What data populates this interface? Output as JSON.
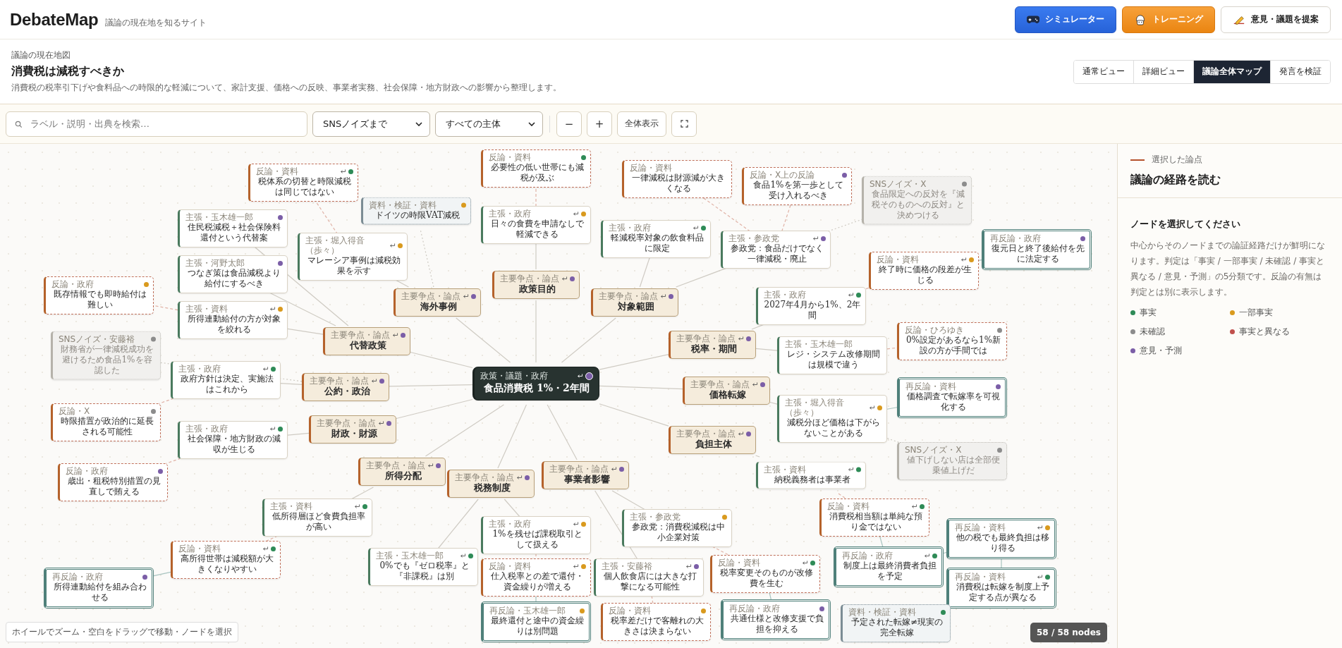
{
  "header": {
    "logo": "DebateMap",
    "tagline": "議論の現在地を知るサイト",
    "buttons": [
      {
        "label": "シミュレーター",
        "kind": "simulator"
      },
      {
        "label": "トレーニング",
        "kind": "training"
      },
      {
        "label": "意見・議題を提案",
        "kind": "propose"
      }
    ]
  },
  "topic": {
    "eyebrow": "議論の現在地図",
    "title": "消費税は減税すべきか",
    "description": "消費税の税率引下げや食料品への時限的な軽減について、家計支援、価格への反映、事業者実務、社会保障・地方財政への影響から整理します。"
  },
  "views": [
    {
      "label": "通常ビュー",
      "selected": false
    },
    {
      "label": "詳細ビュー",
      "selected": false
    },
    {
      "label": "議論全体マップ",
      "selected": true
    },
    {
      "label": "発言を検証",
      "selected": false
    }
  ],
  "toolbar": {
    "search": {
      "placeholder": "ラベル・説明・出典を検索…"
    },
    "filters": [
      {
        "value": "SNSノイズまで"
      },
      {
        "value": "すべての主体"
      }
    ],
    "zoom_buttons": [
      "−",
      "+"
    ],
    "fit_button": "全体表示"
  },
  "map": {
    "root": {
      "kind": "root",
      "meta": "政策・議題・政府",
      "label": "食品消費税 1%・2年間",
      "color": "#7b5ea7",
      "reply": true,
      "children": [
        {
          "kind": "issue",
          "meta": "主要争点・論点",
          "label": "代替政策",
          "color": "#7b5ea7",
          "reply": true,
          "children": [
            {
              "kind": "claim",
              "meta": "主張・玉木雄一郎",
              "label": "住民税減税＋社会保険料還付という代替案",
              "color": "#7b5ea7",
              "reply": false
            },
            {
              "kind": "claim",
              "meta": "主張・河野太郎",
              "label": "つなぎ策は食品減税より給付にするべき",
              "color": "#7b5ea7",
              "reply": false
            },
            {
              "kind": "claim",
              "meta": "主張・資料",
              "label": "所得連動給付の方が対象を絞れる",
              "color": "#d99a1e",
              "reply": true,
              "children": [
                {
                  "kind": "rebuttal",
                  "meta": "反論・政府",
                  "label": "既存情報でも即時給付は難しい",
                  "color": "#d99a1e",
                  "reply": false
                }
              ]
            }
          ]
        },
        {
          "kind": "issue",
          "meta": "主要争点・論点",
          "label": "海外事例",
          "color": "#7b5ea7",
          "reply": true,
          "children": [
            {
              "kind": "claim",
              "meta": "主張・堀入得音（歩々）",
              "label": "マレーシア事例は減税効果を示す",
              "color": "#d99a1e",
              "reply": true,
              "children": [
                {
                  "kind": "rebuttal",
                  "meta": "反論・資料",
                  "label": "税体系の切替と時限減税は同じではない",
                  "color": "#2e8b57",
                  "reply": true
                }
              ]
            },
            {
              "kind": "source",
              "meta": "資料・検証・資料",
              "label": "ドイツの時限VAT減税",
              "color": "#d99a1e",
              "reply": false
            }
          ]
        },
        {
          "kind": "issue",
          "meta": "主要争点・論点",
          "label": "政策目的",
          "color": "#7b5ea7",
          "reply": true,
          "children": [
            {
              "kind": "claim",
              "meta": "主張・政府",
              "label": "日々の食費を申請なしで軽減できる",
              "color": "#d99a1e",
              "reply": true,
              "children": [
                {
                  "kind": "rebuttal",
                  "meta": "反論・資料",
                  "label": "必要性の低い世帯にも減税が及ぶ",
                  "color": "#2e8b57",
                  "reply": false
                }
              ]
            }
          ]
        },
        {
          "kind": "issue",
          "meta": "主要争点・論点",
          "label": "対象範囲",
          "color": "#7b5ea7",
          "reply": true,
          "children": [
            {
              "kind": "claim",
              "meta": "主張・政府",
              "label": "軽減税率対象の飲食料品に限定",
              "color": "#2e8b57",
              "reply": true
            },
            {
              "kind": "claim",
              "meta": "主張・参政党",
              "label": "参政党：食品だけでなく一律減税・廃止",
              "color": "#7b5ea7",
              "reply": true,
              "children": [
                {
                  "kind": "rebuttal",
                  "meta": "反論・資料",
                  "label": "一律減税は財源減が大きくなる",
                  "reply": false
                },
                {
                  "kind": "rebuttal",
                  "meta": "反論・X上の反論",
                  "label": "食品1%を第一歩として受け入れるべき",
                  "color": "#7b5ea7",
                  "reply": false
                },
                {
                  "kind": "noise",
                  "meta": "SNSノイズ・X",
                  "label": "食品限定への反対を『減税そのものへの反対』と決めつける",
                  "color": "#8c8c8c",
                  "reply": false
                }
              ]
            }
          ]
        },
        {
          "kind": "issue",
          "meta": "主要争点・論点",
          "label": "税率・期間",
          "color": "#7b5ea7",
          "reply": true,
          "children": [
            {
              "kind": "claim",
              "meta": "主張・政府",
              "label": "2027年4月から1%、2年間",
              "color": "#2e8b57",
              "reply": true,
              "children": [
                {
                  "kind": "rebuttal",
                  "meta": "反論・資料",
                  "label": "終了時に価格の段差が生じる",
                  "color": "#d99a1e",
                  "reply": true,
                  "children": [
                    {
                      "kind": "counter",
                      "meta": "再反論・政府",
                      "label": "復元日と終了後給付を先に法定する",
                      "color": "#7b5ea7",
                      "reply": false
                    }
                  ]
                }
              ]
            },
            {
              "kind": "claim",
              "meta": "主張・玉木雄一郎",
              "label": "レジ・システム改修期間は規模で違う",
              "reply": false,
              "children": [
                {
                  "kind": "rebuttal",
                  "meta": "反論・ひろゆき",
                  "label": "0%設定があるなら1%新設の方が手間では",
                  "color": "#8c8c8c",
                  "reply": false
                }
              ]
            }
          ]
        },
        {
          "kind": "issue",
          "meta": "主要争点・論点",
          "label": "価格転嫁",
          "color": "#7b5ea7",
          "reply": true,
          "children": [
            {
              "kind": "claim",
              "meta": "主張・堀入得音（歩々）",
              "label": "減税分ほど価格は下がらないことがある",
              "color": "#d99a1e",
              "reply": true,
              "children": [
                {
                  "kind": "counter",
                  "meta": "再反論・資料",
                  "label": "価格調査で転嫁率を可視化する",
                  "color": "#7b5ea7",
                  "reply": false
                },
                {
                  "kind": "noise",
                  "meta": "SNSノイズ・X",
                  "label": "値下げしない店は全部便乗値上げだ",
                  "color": "#8c8c8c",
                  "reply": false
                }
              ]
            }
          ]
        },
        {
          "kind": "issue",
          "meta": "主要争点・論点",
          "label": "負担主体",
          "color": "#7b5ea7",
          "reply": true,
          "children": [
            {
              "kind": "claim",
              "meta": "主張・資料",
              "label": "納税義務者は事業者",
              "color": "#2e8b57",
              "reply": true,
              "children": [
                {
                  "kind": "rebuttal",
                  "meta": "反論・資料",
                  "label": "消費税相当額は単純な預り金ではない",
                  "color": "#2e8b57",
                  "reply": true,
                  "children": [
                    {
                      "kind": "counter",
                      "meta": "再反論・政府",
                      "label": "制度上は最終消費者負担を予定",
                      "color": "#2e8b57",
                      "reply": true,
                      "children": [
                        {
                          "kind": "counter",
                          "meta": "再反論・資料",
                          "label": "他の税でも最終負担は移り得る",
                          "color": "#d99a1e",
                          "reply": true,
                          "children": [
                            {
                              "kind": "counter",
                              "meta": "再反論・資料",
                              "label": "消費税は転嫁を制度上予定する点が異なる",
                              "color": "#2e8b57",
                              "reply": true,
                              "children": [
                                {
                                  "kind": "source",
                                  "meta": "資料・検証・資料",
                                  "label": "予定された転嫁≠現実の完全転嫁",
                                  "color": "#2e8b57",
                                  "reply": false
                                }
                              ]
                            }
                          ]
                        }
                      ]
                    }
                  ]
                }
              ]
            }
          ]
        },
        {
          "kind": "issue",
          "meta": "主要争点・論点",
          "label": "事業者影響",
          "color": "#7b5ea7",
          "reply": true,
          "children": [
            {
              "kind": "claim",
              "meta": "主張・参政党",
              "label": "参政党：消費税減税は中小企業対策",
              "color": "#d99a1e",
              "reply": false,
              "children": [
                {
                  "kind": "rebuttal",
                  "meta": "反論・資料",
                  "label": "税率変更そのものが改修費を生む",
                  "color": "#2e8b57",
                  "reply": true,
                  "children": [
                    {
                      "kind": "counter",
                      "meta": "再反論・政府",
                      "label": "共通仕様と改修支援で負担を抑える",
                      "color": "#7b5ea7",
                      "reply": false
                    }
                  ]
                }
              ]
            },
            {
              "kind": "claim",
              "meta": "主張・安藤裕",
              "label": "個人飲食店には大きな打撃になる可能性",
              "color": "#7b5ea7",
              "reply": true,
              "children": [
                {
                  "kind": "rebuttal",
                  "meta": "反論・資料",
                  "label": "税率差だけで客離れの大きさは決まらない",
                  "color": "#d99a1e",
                  "reply": false
                }
              ]
            }
          ]
        },
        {
          "kind": "issue",
          "meta": "主要争点・論点",
          "label": "公約・政治",
          "color": "#7b5ea7",
          "reply": true,
          "children": [
            {
              "kind": "claim",
              "meta": "主張・政府",
              "label": "政府方針は決定、実施法はこれから",
              "color": "#2e8b57",
              "reply": true,
              "children": [
                {
                  "kind": "rebuttal",
                  "meta": "反論・X",
                  "label": "時限措置が政治的に延長される可能性",
                  "color": "#8c8c8c",
                  "reply": false
                }
              ]
            },
            {
              "kind": "noise",
              "meta": "SNSノイズ・安藤裕",
              "label": "財務省が一律減税成功を避けるため食品1%を容認した",
              "color": "#8c8c8c",
              "reply": false
            }
          ]
        },
        {
          "kind": "issue",
          "meta": "主要争点・論点",
          "label": "財政・財源",
          "color": "#7b5ea7",
          "reply": true,
          "children": [
            {
              "kind": "claim",
              "meta": "主張・政府",
              "label": "社会保障・地方財政の減収が生じる",
              "color": "#2e8b57",
              "reply": true,
              "children": [
                {
                  "kind": "rebuttal",
                  "meta": "反論・政府",
                  "label": "歳出・租税特別措置の見直しで賄える",
                  "color": "#7b5ea7",
                  "reply": false
                }
              ]
            }
          ]
        },
        {
          "kind": "issue",
          "meta": "主要争点・論点",
          "label": "所得分配",
          "color": "#7b5ea7",
          "reply": true,
          "children": [
            {
              "kind": "claim",
              "meta": "主張・資料",
              "label": "低所得層ほど食費負担率が高い",
              "color": "#2e8b57",
              "reply": true,
              "children": [
                {
                  "kind": "rebuttal",
                  "meta": "反論・資料",
                  "label": "高所得世帯は減税額が大きくなりやすい",
                  "color": "#2e8b57",
                  "reply": true,
                  "children": [
                    {
                      "kind": "counter",
                      "meta": "再反論・政府",
                      "label": "所得連動給付を組み合わせる",
                      "color": "#7b5ea7",
                      "reply": false
                    }
                  ]
                }
              ]
            }
          ]
        },
        {
          "kind": "issue",
          "meta": "主要争点・論点",
          "label": "税務制度",
          "color": "#7b5ea7",
          "reply": true,
          "children": [
            {
              "kind": "claim",
              "meta": "主張・玉木雄一郎",
              "label": "0%でも『ゼロ税率』と『非課税』は別",
              "color": "#2e8b57",
              "reply": true
            },
            {
              "kind": "claim",
              "meta": "主張・政府",
              "label": "1%を残せば課税取引として扱える",
              "color": "#d99a1e",
              "reply": true,
              "children": [
                {
                  "kind": "rebuttal",
                  "meta": "反論・資料",
                  "label": "仕入税率との差で還付・資金繰りが増える",
                  "color": "#d99a1e",
                  "reply": true,
                  "children": [
                    {
                      "kind": "counter",
                      "meta": "再反論・玉木雄一郎",
                      "label": "最終還付と途中の資金繰りは別問題",
                      "color": "#d99a1e",
                      "reply": false
                    }
                  ]
                }
              ]
            }
          ]
        }
      ]
    },
    "hint": "ホイールでズーム・空白をドラッグで移動・ノードを選択",
    "node_count": "58 / 58 nodes"
  },
  "panel": {
    "eyebrow": "選択した論点",
    "title": "議論の経路を読む",
    "prompt": "ノードを選択してください",
    "body": "中心からそのノードまでの論証経路だけが鮮明になります。判定は「事実 / 一部事実 / 未確認 / 事実と異なる / 意見・予測」の5分類です。反論の有無は判定とは別に表示します。",
    "legend": [
      {
        "label": "事実",
        "color": "#2e8b57"
      },
      {
        "label": "一部事実",
        "color": "#d99a1e"
      },
      {
        "label": "未確認",
        "color": "#8c8c8c"
      },
      {
        "label": "事実と異なる",
        "color": "#c0504d"
      },
      {
        "label": "意見・予測",
        "color": "#7b5ea7"
      }
    ]
  }
}
